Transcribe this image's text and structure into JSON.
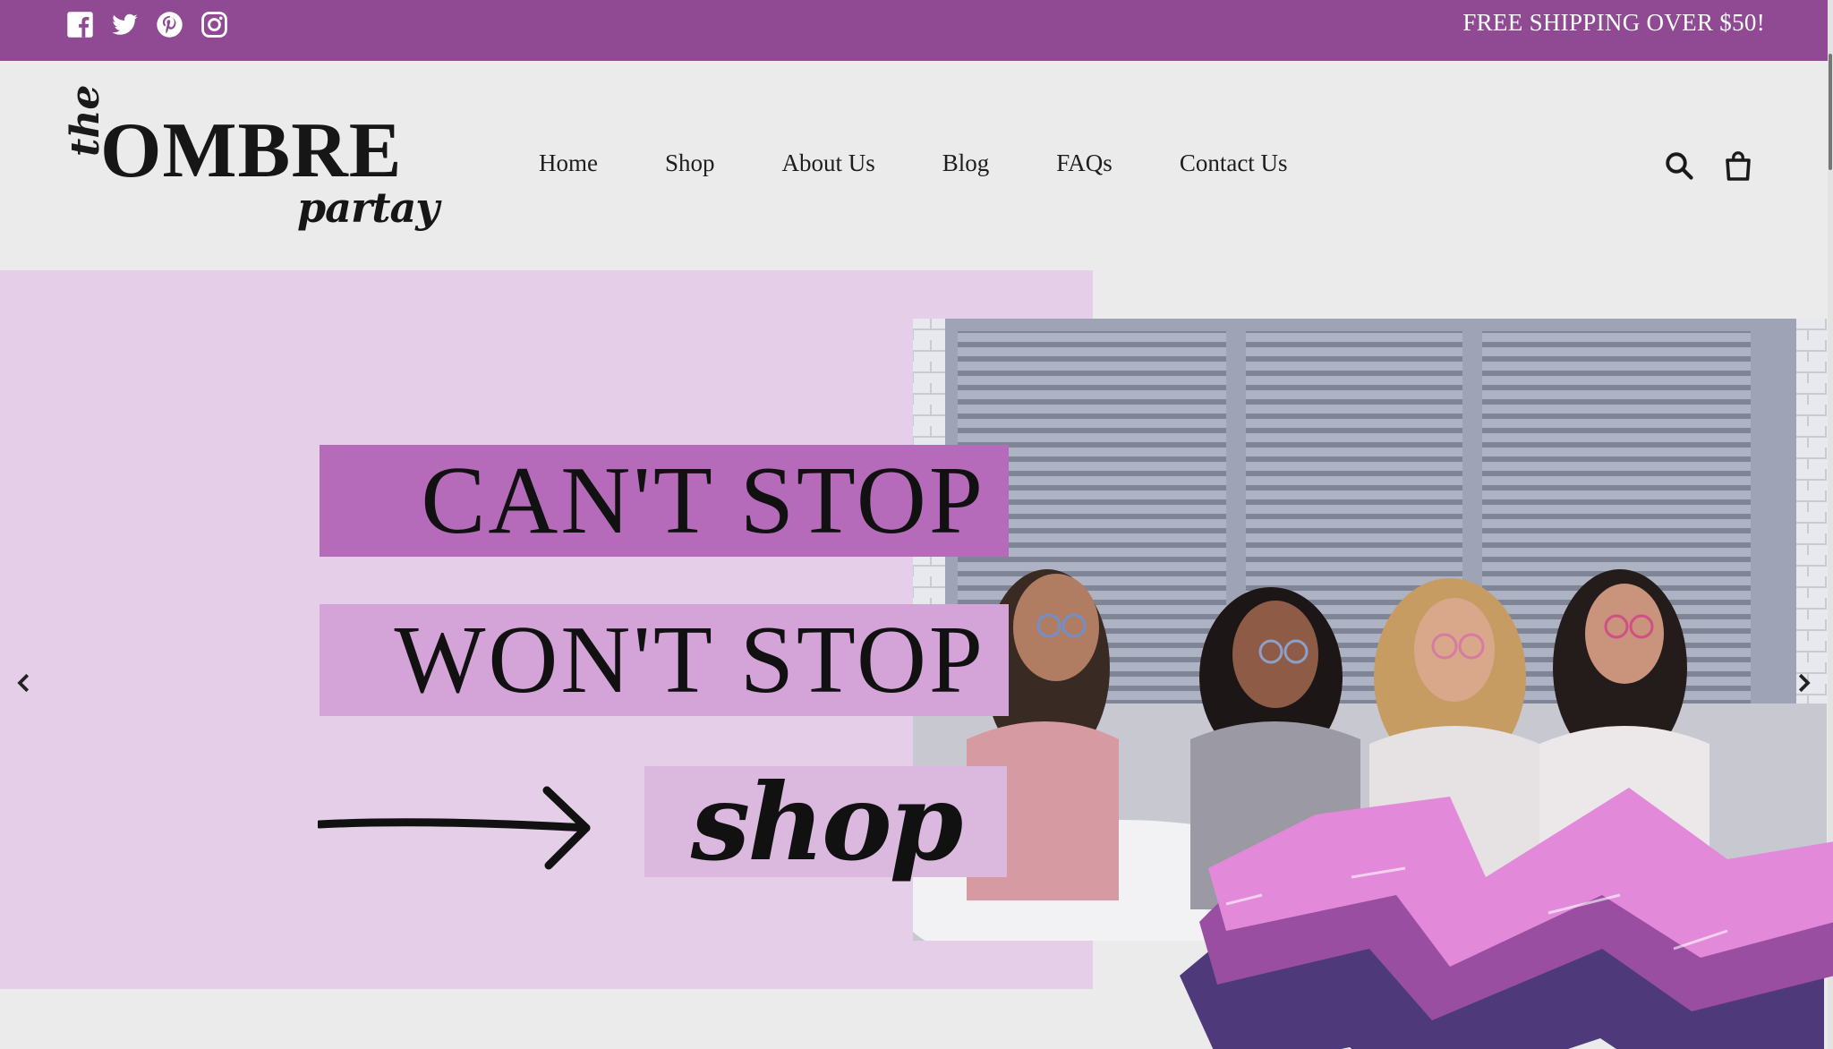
{
  "topbar": {
    "shipping_text": "FREE SHIPPING OVER $50!",
    "social_icons": [
      "facebook-icon",
      "twitter-icon",
      "pinterest-icon",
      "instagram-icon"
    ]
  },
  "logo": {
    "prefix": "the",
    "main": "OMBRE",
    "sub": "partay"
  },
  "nav": {
    "items": [
      {
        "label": "Home"
      },
      {
        "label": "Shop"
      },
      {
        "label": "About Us"
      },
      {
        "label": "Blog"
      },
      {
        "label": "FAQs"
      },
      {
        "label": "Contact Us"
      }
    ]
  },
  "header_icons": [
    "search-icon",
    "cart-icon"
  ],
  "hero": {
    "line1": "CAN'T STOP",
    "line2": "WON'T STOP",
    "cta": "shop",
    "carousel_icons": [
      "chevron-left-icon",
      "chevron-right-icon"
    ]
  },
  "colors": {
    "topbar": "#8f4a93",
    "page_bg": "#ebebeb",
    "hero_bg": "#e5cfe8",
    "box_dark": "#b56bb9",
    "box_mid": "#d4a3d8",
    "box_light": "#dbb9df",
    "brush_dark": "#4e3a7a",
    "brush_mid": "#9a4ea2",
    "brush_light": "#e28ad9"
  }
}
